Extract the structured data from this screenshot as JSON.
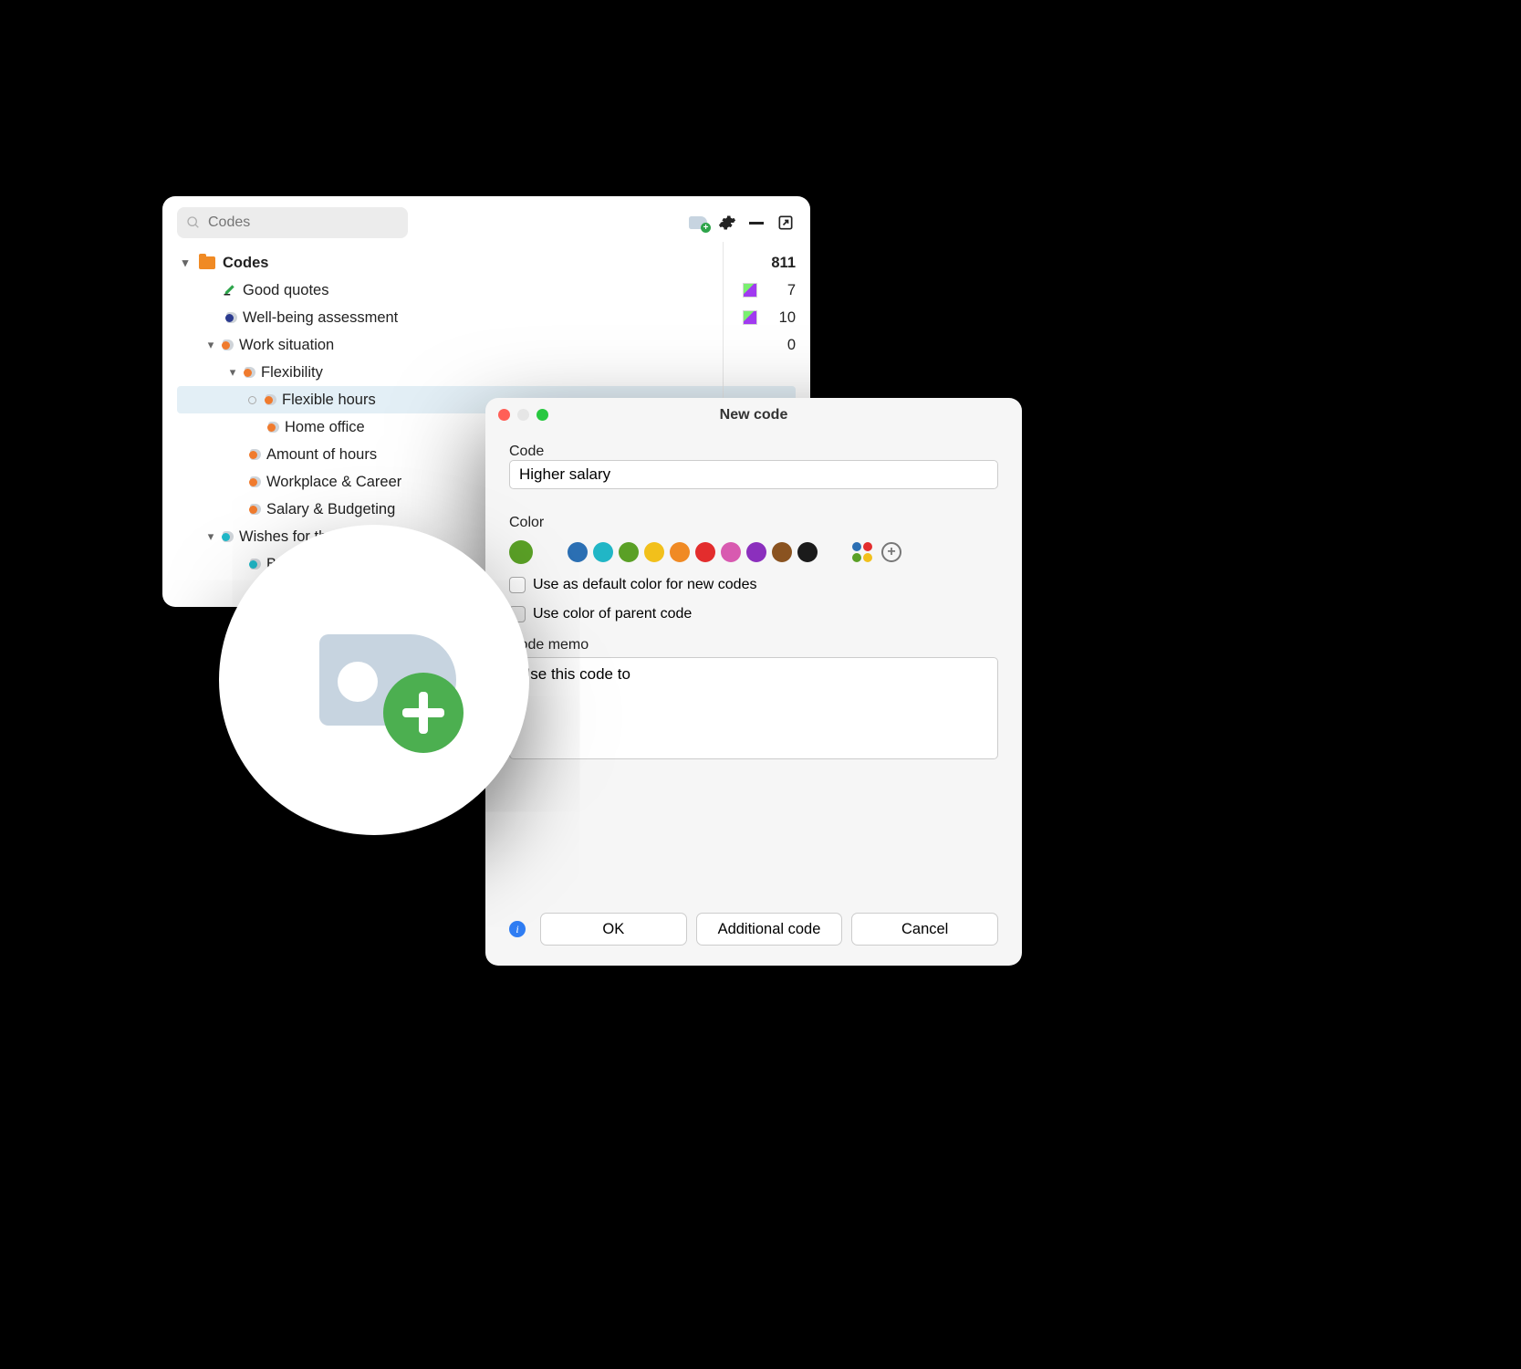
{
  "codes_panel": {
    "search_placeholder": "Codes",
    "root_label": "Codes",
    "root_count": 811,
    "items": [
      {
        "label": "Good quotes",
        "count": 7,
        "dot": "#1fa93a",
        "kind": "marker",
        "badge": true
      },
      {
        "label": "Well-being assessment",
        "count": 10,
        "dot": "#2b3a8f",
        "badge": true
      },
      {
        "label": "Work situation",
        "count": 0,
        "dot": "#f07b2e",
        "expanded": true,
        "children": [
          {
            "label": "Flexibility",
            "dot": "#f07b2e",
            "expanded": true,
            "children": [
              {
                "label": "Flexible hours",
                "dot": "#f07b2e",
                "selected": true,
                "hollow_prefix": true
              },
              {
                "label": "Home office",
                "dot": "#f07b2e"
              }
            ]
          },
          {
            "label": "Amount of hours",
            "dot": "#f07b2e"
          },
          {
            "label": "Workplace & Career",
            "dot": "#f07b2e"
          },
          {
            "label": "Salary & Budgeting",
            "dot": "#f07b2e"
          }
        ]
      },
      {
        "label": "Wishes for the future",
        "dot": "#20b8c8",
        "expanded": true,
        "children": [
          {
            "label": "Better",
            "dot": "#20b8c8"
          }
        ]
      }
    ]
  },
  "dialog": {
    "title": "New code",
    "code_label": "Code",
    "code_value": "Higher salary",
    "color_label": "Color",
    "selected_color": "#5aa026",
    "palette": [
      "#2b6fb3",
      "#21b6c6",
      "#5aa026",
      "#f2c01b",
      "#f08a24",
      "#e32d2d",
      "#d85ab0",
      "#8b2fbd",
      "#8a5320",
      "#1b1b1b"
    ],
    "checkbox1": "Use as default color for new codes",
    "checkbox2": "Use color of parent code",
    "memo_label": "Code memo",
    "memo_value": "Use this code to",
    "buttons": {
      "ok": "OK",
      "additional": "Additional code",
      "cancel": "Cancel"
    }
  }
}
